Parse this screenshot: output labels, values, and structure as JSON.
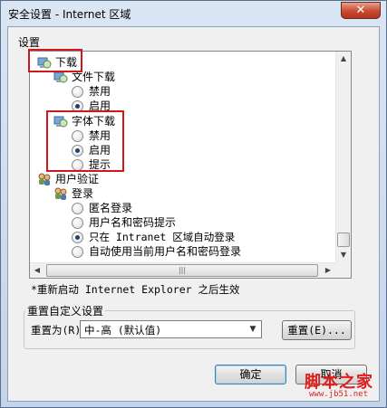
{
  "window": {
    "title": "安全设置 - Internet 区域",
    "close_glyph": "✕"
  },
  "settings_label": "设置",
  "tree": {
    "download": "下载",
    "file_download": "文件下载",
    "disable_1": "禁用",
    "enable_1": "启用",
    "font_download": "字体下载",
    "disable_2": "禁用",
    "enable_2": "启用",
    "prompt": "提示",
    "user_auth": "用户验证",
    "logon": "登录",
    "anon_logon": "匿名登录",
    "prompt_user": "用户名和密码提示",
    "auto_intranet": "只在 Intranet 区域自动登录",
    "auto_current": "自动使用当前用户名和密码登录"
  },
  "icons": {
    "settings_folder": "settings-folder-icon",
    "users": "users-icon"
  },
  "note": "*重新启动 Internet Explorer 之后生效",
  "reset_group": {
    "title": "重置自定义设置",
    "reset_to_label": "重置为(R):",
    "level_value": "中-高 (默认值)",
    "reset_button": "重置(E)..."
  },
  "buttons": {
    "ok": "确定",
    "cancel": "取消"
  },
  "watermark": {
    "line1": "脚本之家",
    "line2": "www.jb51.net"
  },
  "colors": {
    "highlight_box": "#d01818",
    "close_button": "#c74a30"
  }
}
